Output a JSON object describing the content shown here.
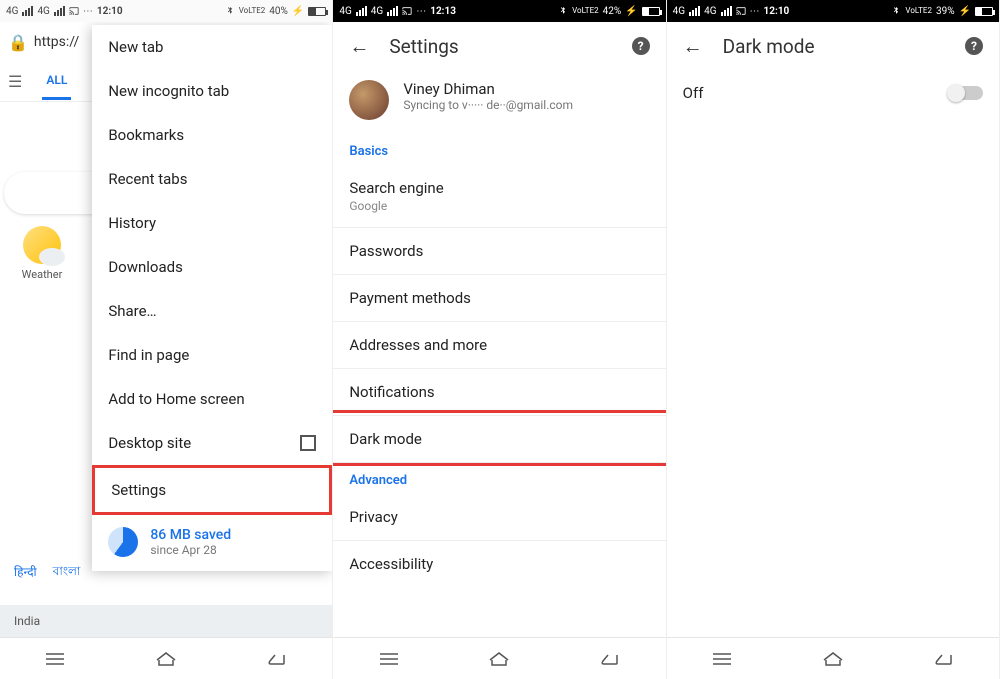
{
  "phone1": {
    "status": {
      "net": "4G",
      "time": "12:10",
      "volte": "VoLTE2",
      "batt_pct": "40%",
      "batt_fill": 40
    },
    "omni": "https://",
    "tab_all": "ALL",
    "weather_label": "Weather",
    "langs": [
      "हिन्दी",
      "বাংলা"
    ],
    "footer": "India",
    "menu": {
      "items": [
        "New tab",
        "New incognito tab",
        "Bookmarks",
        "Recent tabs",
        "History",
        "Downloads",
        "Share…",
        "Find in page",
        "Add to Home screen"
      ],
      "desktop": "Desktop site",
      "settings": "Settings",
      "saved_t1": "86 MB saved",
      "saved_t2": "since Apr 28"
    }
  },
  "phone2": {
    "status": {
      "net": "4G",
      "time": "12:13",
      "volte": "VoLTE2",
      "batt_pct": "42%",
      "batt_fill": 42
    },
    "title": "Settings",
    "account": {
      "name": "Viney Dhiman",
      "sync": "Syncing to v····· de··@gmail.com"
    },
    "section_basics": "Basics",
    "search_engine": "Search engine",
    "search_engine_val": "Google",
    "rows": [
      "Passwords",
      "Payment methods",
      "Addresses and more",
      "Notifications"
    ],
    "dark_mode": "Dark mode",
    "section_adv": "Advanced",
    "rows_adv": [
      "Privacy",
      "Accessibility"
    ]
  },
  "phone3": {
    "status": {
      "net": "4G",
      "time": "12:10",
      "volte": "VoLTE2",
      "batt_pct": "39%",
      "batt_fill": 39
    },
    "title": "Dark mode",
    "toggle_label": "Off"
  }
}
